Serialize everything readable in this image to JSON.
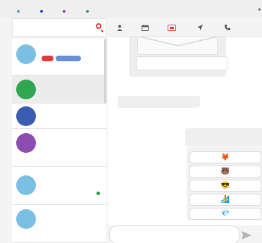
{
  "window": {
    "dots": [
      "#4aa3df",
      "#2d4fb5",
      "#8b44b0",
      "#27a64a"
    ]
  },
  "search": {
    "value": "",
    "icon": "search-icon"
  },
  "chats": [
    {
      "avatar_color": "#7bbfe3",
      "badges": [
        "#e0393e",
        "#6a8fd6"
      ]
    },
    {
      "avatar_color": "#2fa64f",
      "active": true
    },
    {
      "avatar_color": "#3a5cb2"
    },
    {
      "avatar_color": "#8b4eb0"
    },
    {
      "avatar_color": "#7bbfe3",
      "online": true
    },
    {
      "avatar_color": "#7bbfe3"
    }
  ],
  "toolbar": {
    "buttons": [
      "person-icon",
      "calendar-icon",
      "ticket-icon",
      "location-arrow-icon",
      "phone-icon"
    ],
    "accent": "#e0393e"
  },
  "quick_replies": [
    "🦊",
    "🐻",
    "😎",
    "🏄",
    "💎"
  ],
  "composer": {
    "placeholder": "",
    "send_icon": "send-icon"
  }
}
